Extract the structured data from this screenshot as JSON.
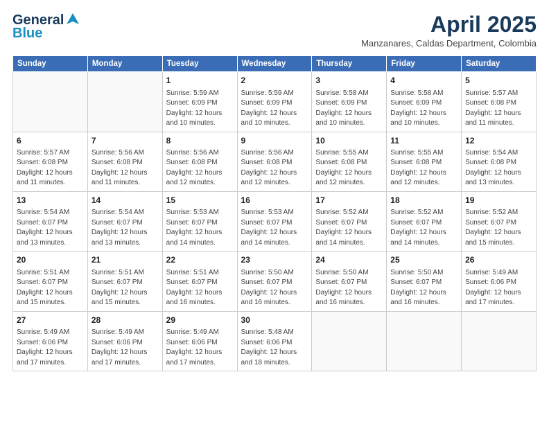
{
  "logo": {
    "line1": "General",
    "line2": "Blue"
  },
  "title": "April 2025",
  "location": "Manzanares, Caldas Department, Colombia",
  "days_of_week": [
    "Sunday",
    "Monday",
    "Tuesday",
    "Wednesday",
    "Thursday",
    "Friday",
    "Saturday"
  ],
  "weeks": [
    [
      {
        "num": "",
        "detail": ""
      },
      {
        "num": "",
        "detail": ""
      },
      {
        "num": "1",
        "detail": "Sunrise: 5:59 AM\nSunset: 6:09 PM\nDaylight: 12 hours and 10 minutes."
      },
      {
        "num": "2",
        "detail": "Sunrise: 5:59 AM\nSunset: 6:09 PM\nDaylight: 12 hours and 10 minutes."
      },
      {
        "num": "3",
        "detail": "Sunrise: 5:58 AM\nSunset: 6:09 PM\nDaylight: 12 hours and 10 minutes."
      },
      {
        "num": "4",
        "detail": "Sunrise: 5:58 AM\nSunset: 6:09 PM\nDaylight: 12 hours and 10 minutes."
      },
      {
        "num": "5",
        "detail": "Sunrise: 5:57 AM\nSunset: 6:08 PM\nDaylight: 12 hours and 11 minutes."
      }
    ],
    [
      {
        "num": "6",
        "detail": "Sunrise: 5:57 AM\nSunset: 6:08 PM\nDaylight: 12 hours and 11 minutes."
      },
      {
        "num": "7",
        "detail": "Sunrise: 5:56 AM\nSunset: 6:08 PM\nDaylight: 12 hours and 11 minutes."
      },
      {
        "num": "8",
        "detail": "Sunrise: 5:56 AM\nSunset: 6:08 PM\nDaylight: 12 hours and 12 minutes."
      },
      {
        "num": "9",
        "detail": "Sunrise: 5:56 AM\nSunset: 6:08 PM\nDaylight: 12 hours and 12 minutes."
      },
      {
        "num": "10",
        "detail": "Sunrise: 5:55 AM\nSunset: 6:08 PM\nDaylight: 12 hours and 12 minutes."
      },
      {
        "num": "11",
        "detail": "Sunrise: 5:55 AM\nSunset: 6:08 PM\nDaylight: 12 hours and 12 minutes."
      },
      {
        "num": "12",
        "detail": "Sunrise: 5:54 AM\nSunset: 6:08 PM\nDaylight: 12 hours and 13 minutes."
      }
    ],
    [
      {
        "num": "13",
        "detail": "Sunrise: 5:54 AM\nSunset: 6:07 PM\nDaylight: 12 hours and 13 minutes."
      },
      {
        "num": "14",
        "detail": "Sunrise: 5:54 AM\nSunset: 6:07 PM\nDaylight: 12 hours and 13 minutes."
      },
      {
        "num": "15",
        "detail": "Sunrise: 5:53 AM\nSunset: 6:07 PM\nDaylight: 12 hours and 14 minutes."
      },
      {
        "num": "16",
        "detail": "Sunrise: 5:53 AM\nSunset: 6:07 PM\nDaylight: 12 hours and 14 minutes."
      },
      {
        "num": "17",
        "detail": "Sunrise: 5:52 AM\nSunset: 6:07 PM\nDaylight: 12 hours and 14 minutes."
      },
      {
        "num": "18",
        "detail": "Sunrise: 5:52 AM\nSunset: 6:07 PM\nDaylight: 12 hours and 14 minutes."
      },
      {
        "num": "19",
        "detail": "Sunrise: 5:52 AM\nSunset: 6:07 PM\nDaylight: 12 hours and 15 minutes."
      }
    ],
    [
      {
        "num": "20",
        "detail": "Sunrise: 5:51 AM\nSunset: 6:07 PM\nDaylight: 12 hours and 15 minutes."
      },
      {
        "num": "21",
        "detail": "Sunrise: 5:51 AM\nSunset: 6:07 PM\nDaylight: 12 hours and 15 minutes."
      },
      {
        "num": "22",
        "detail": "Sunrise: 5:51 AM\nSunset: 6:07 PM\nDaylight: 12 hours and 16 minutes."
      },
      {
        "num": "23",
        "detail": "Sunrise: 5:50 AM\nSunset: 6:07 PM\nDaylight: 12 hours and 16 minutes."
      },
      {
        "num": "24",
        "detail": "Sunrise: 5:50 AM\nSunset: 6:07 PM\nDaylight: 12 hours and 16 minutes."
      },
      {
        "num": "25",
        "detail": "Sunrise: 5:50 AM\nSunset: 6:07 PM\nDaylight: 12 hours and 16 minutes."
      },
      {
        "num": "26",
        "detail": "Sunrise: 5:49 AM\nSunset: 6:06 PM\nDaylight: 12 hours and 17 minutes."
      }
    ],
    [
      {
        "num": "27",
        "detail": "Sunrise: 5:49 AM\nSunset: 6:06 PM\nDaylight: 12 hours and 17 minutes."
      },
      {
        "num": "28",
        "detail": "Sunrise: 5:49 AM\nSunset: 6:06 PM\nDaylight: 12 hours and 17 minutes."
      },
      {
        "num": "29",
        "detail": "Sunrise: 5:49 AM\nSunset: 6:06 PM\nDaylight: 12 hours and 17 minutes."
      },
      {
        "num": "30",
        "detail": "Sunrise: 5:48 AM\nSunset: 6:06 PM\nDaylight: 12 hours and 18 minutes."
      },
      {
        "num": "",
        "detail": ""
      },
      {
        "num": "",
        "detail": ""
      },
      {
        "num": "",
        "detail": ""
      }
    ]
  ]
}
